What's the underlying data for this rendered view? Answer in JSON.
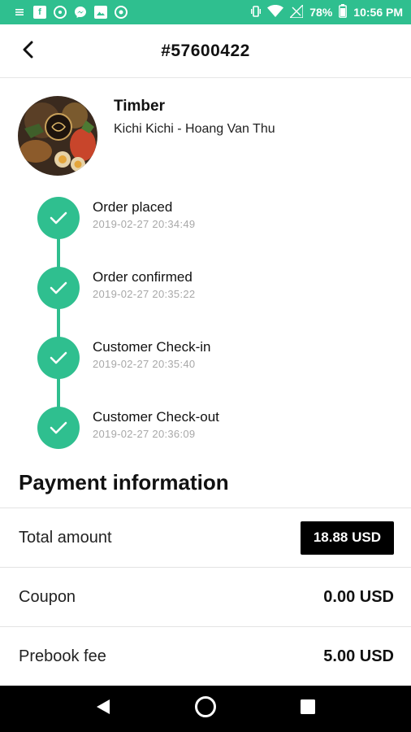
{
  "status_bar": {
    "battery": "78%",
    "time": "10:56 PM",
    "icons": [
      "overflow-icon",
      "facebook-icon",
      "notification-icon",
      "messenger-icon",
      "gallery-icon",
      "record-icon"
    ],
    "system_icons": [
      "vibrate-icon",
      "wifi-icon",
      "no-signal-icon",
      "battery-icon"
    ]
  },
  "header": {
    "title": "#57600422",
    "back_icon": "chevron-left-icon"
  },
  "restaurant": {
    "name": "Timber",
    "address": "Kichi Kichi - Hoang Van Thu"
  },
  "timeline": [
    {
      "title": "Order placed",
      "time": "2019-02-27 20:34:49"
    },
    {
      "title": "Order confirmed",
      "time": "2019-02-27 20:35:22"
    },
    {
      "title": "Customer Check-in",
      "time": "2019-02-27 20:35:40"
    },
    {
      "title": "Customer Check-out",
      "time": "2019-02-27 20:36:09"
    }
  ],
  "payment": {
    "heading": "Payment information",
    "rows": [
      {
        "label": "Total amount",
        "value": "18.88 USD"
      },
      {
        "label": "Coupon",
        "value": "0.00 USD"
      },
      {
        "label": "Prebook fee",
        "value": "5.00 USD"
      }
    ]
  },
  "colors": {
    "accent": "#2fbf8f",
    "badge_bg": "#000000",
    "muted_text": "#a8a8a8"
  },
  "nav_bar": {
    "icons": [
      "back-triangle-icon",
      "home-circle-icon",
      "recents-square-icon"
    ]
  }
}
